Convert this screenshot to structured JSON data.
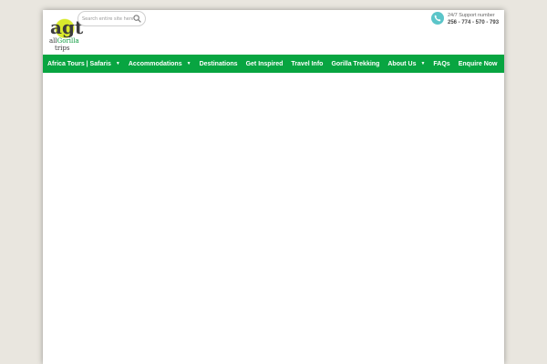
{
  "logo": {
    "mark": "agt",
    "line1_prefix": "all",
    "line1_highlight": "Gorilla",
    "line2": "trips",
    "accent_color": "#d8ea2c",
    "text_color": "#0a9a3c"
  },
  "search": {
    "placeholder": "Search entire site here...",
    "value": "",
    "icon": "search-icon"
  },
  "support": {
    "label": "24/7 Support number",
    "number": "256 - 774 - 570 - 793",
    "icon": "phone-icon",
    "icon_color": "#5bc5c9"
  },
  "nav": {
    "background": "#08a541",
    "items": [
      {
        "label": "Africa Tours | Safaris",
        "dropdown": true
      },
      {
        "label": "Accommodations",
        "dropdown": true
      },
      {
        "label": "Destinations",
        "dropdown": false
      },
      {
        "label": "Get Inspired",
        "dropdown": false
      },
      {
        "label": "Travel Info",
        "dropdown": false
      },
      {
        "label": "Gorilla Trekking",
        "dropdown": false
      },
      {
        "label": "About Us",
        "dropdown": true
      },
      {
        "label": "FAQs",
        "dropdown": false
      },
      {
        "label": "Enquire Now",
        "dropdown": false
      }
    ]
  }
}
